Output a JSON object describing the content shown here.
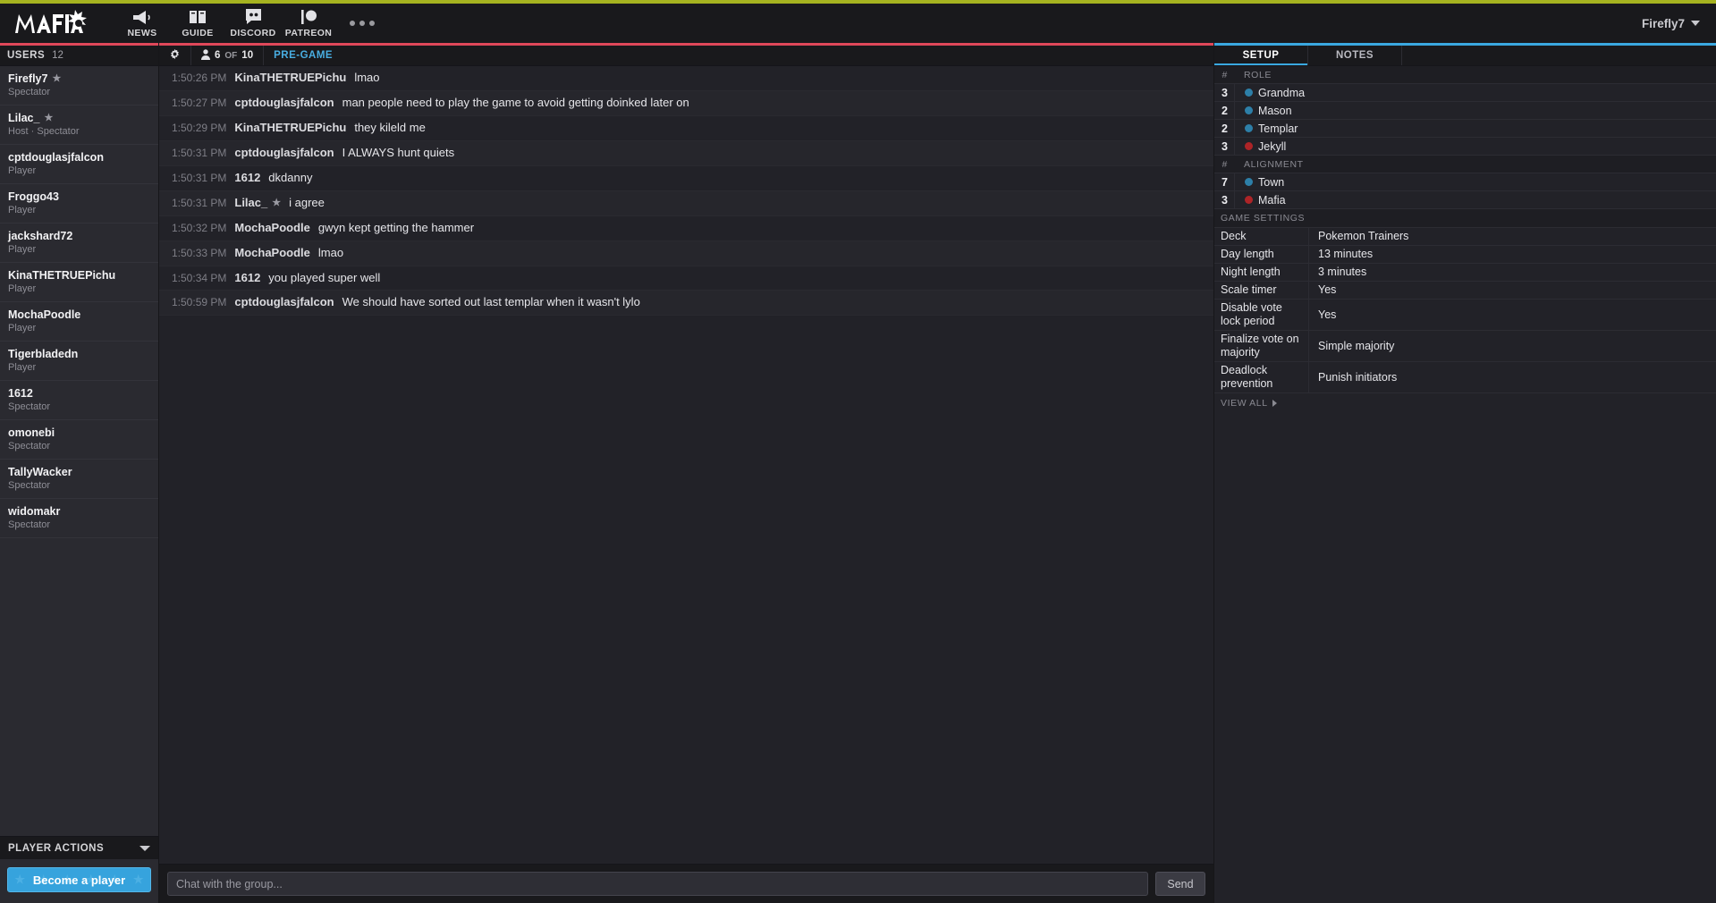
{
  "navbar": {
    "logo_text": "MAFIA",
    "items": [
      {
        "label": "NEWS",
        "icon": "megaphone-icon"
      },
      {
        "label": "GUIDE",
        "icon": "book-icon"
      },
      {
        "label": "DISCORD",
        "icon": "discord-icon"
      },
      {
        "label": "PATREON",
        "icon": "patreon-icon"
      }
    ],
    "more_icon": "ellipsis-icon",
    "user": "Firefly7",
    "user_caret_icon": "chevron-down-icon",
    "accent_stripe_color": "#a6b320"
  },
  "sidebar": {
    "title": "USERS",
    "count": "12",
    "users": [
      {
        "name": "Firefly7",
        "role": "Spectator",
        "star": true
      },
      {
        "name": "Lilac_",
        "role": "Host · Spectator",
        "star": true
      },
      {
        "name": "cptdouglasjfalcon",
        "role": "Player",
        "star": false
      },
      {
        "name": "Froggo43",
        "role": "Player",
        "star": false
      },
      {
        "name": "jackshard72",
        "role": "Player",
        "star": false
      },
      {
        "name": "KinaTHETRUEPichu",
        "role": "Player",
        "star": false
      },
      {
        "name": "MochaPoodle",
        "role": "Player",
        "star": false
      },
      {
        "name": "Tigerbladedn",
        "role": "Player",
        "star": false
      },
      {
        "name": "1612",
        "role": "Spectator",
        "star": false
      },
      {
        "name": "omonebi",
        "role": "Spectator",
        "star": false
      },
      {
        "name": "TallyWacker",
        "role": "Spectator",
        "star": false
      },
      {
        "name": "widomakr",
        "role": "Spectator",
        "star": false
      }
    ],
    "player_actions_title": "PLAYER ACTIONS",
    "become_player_label": "Become a player"
  },
  "chat": {
    "gear_icon": "gear-icon",
    "person_icon": "person-icon",
    "player_count": "6",
    "of_label": "OF",
    "player_max": "10",
    "phase": "PRE-GAME",
    "messages": [
      {
        "time": "1:50:26 PM",
        "author": "KinaTHETRUEPichu",
        "star": false,
        "text": "lmao"
      },
      {
        "time": "1:50:27 PM",
        "author": "cptdouglasjfalcon",
        "star": false,
        "text": "man people need to play the game to avoid getting doinked later on"
      },
      {
        "time": "1:50:29 PM",
        "author": "KinaTHETRUEPichu",
        "star": false,
        "text": "they kileld me"
      },
      {
        "time": "1:50:31 PM",
        "author": "cptdouglasjfalcon",
        "star": false,
        "text": "I ALWAYS hunt quiets"
      },
      {
        "time": "1:50:31 PM",
        "author": "1612",
        "star": false,
        "text": "dkdanny"
      },
      {
        "time": "1:50:31 PM",
        "author": "Lilac_",
        "star": true,
        "text": "i agree"
      },
      {
        "time": "1:50:32 PM",
        "author": "MochaPoodle",
        "star": false,
        "text": "gwyn kept getting the hammer"
      },
      {
        "time": "1:50:33 PM",
        "author": "MochaPoodle",
        "star": false,
        "text": "lmao"
      },
      {
        "time": "1:50:34 PM",
        "author": "1612",
        "star": false,
        "text": "you played super well"
      },
      {
        "time": "1:50:59 PM",
        "author": "cptdouglasjfalcon",
        "star": false,
        "text": "We should have sorted out last templar when it wasn't lylo"
      }
    ],
    "input_placeholder": "Chat with the group...",
    "input_value": "",
    "send_label": "Send"
  },
  "right_panel": {
    "tabs": [
      {
        "label": "SETUP",
        "active": true
      },
      {
        "label": "NOTES",
        "active": false
      }
    ],
    "role_header": {
      "hash": "#",
      "label": "ROLE"
    },
    "roles": [
      {
        "count": "3",
        "name": "Grandma",
        "color": "#2d7fa8"
      },
      {
        "count": "2",
        "name": "Mason",
        "color": "#2d7fa8"
      },
      {
        "count": "2",
        "name": "Templar",
        "color": "#2d7fa8"
      },
      {
        "count": "3",
        "name": "Jekyll",
        "color": "#ad2427"
      }
    ],
    "alignment_header": {
      "hash": "#",
      "label": "ALIGNMENT"
    },
    "alignments": [
      {
        "count": "7",
        "name": "Town",
        "color": "#2d7fa8"
      },
      {
        "count": "3",
        "name": "Mafia",
        "color": "#ad2427"
      }
    ],
    "game_settings_title": "GAME SETTINGS",
    "game_settings": [
      {
        "key": "Deck",
        "value": "Pokemon Trainers"
      },
      {
        "key": "Day length",
        "value": "13 minutes"
      },
      {
        "key": "Night length",
        "value": "3 minutes"
      },
      {
        "key": "Scale timer",
        "value": "Yes"
      },
      {
        "key": "Disable vote lock period",
        "value": "Yes"
      },
      {
        "key": "Finalize vote on majority",
        "value": "Simple majority"
      },
      {
        "key": "Deadlock prevention",
        "value": "Punish initiators"
      }
    ],
    "view_all_label": "VIEW ALL"
  }
}
